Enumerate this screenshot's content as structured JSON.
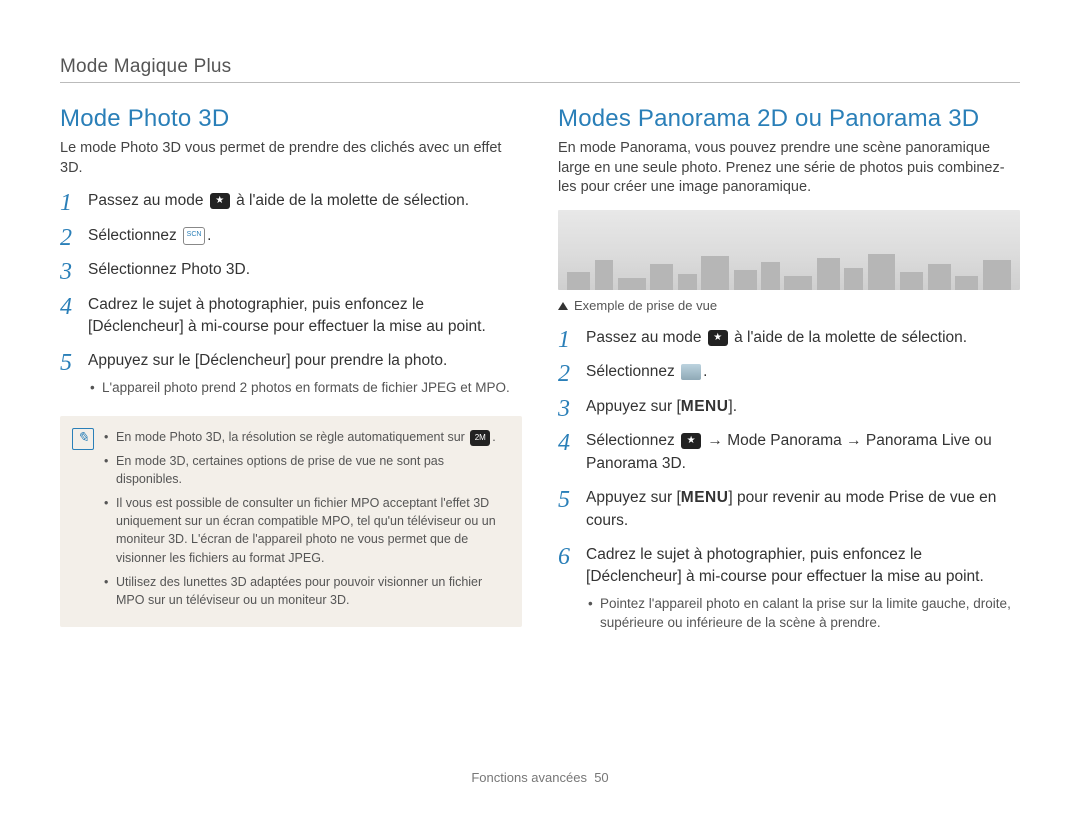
{
  "header": {
    "title": "Mode Magique Plus"
  },
  "left": {
    "heading": "Mode Photo 3D",
    "intro": "Le mode Photo 3D vous permet de prendre des clichés avec un effet 3D.",
    "steps": [
      {
        "pre": "Passez au mode ",
        "post": " à l'aide de la molette de sélection."
      },
      {
        "pre": "Sélectionnez ",
        "post": "."
      },
      {
        "pre": "Sélectionnez ",
        "bold": "Photo 3D",
        "post": "."
      },
      {
        "text": "Cadrez le sujet à photographier, puis enfoncez le [",
        "bold": "Déclencheur",
        "post": "] à mi-course pour effectuer la mise au point."
      },
      {
        "pre": "Appuyez sur le [",
        "bold": "Déclencheur",
        "post": "] pour prendre la photo.",
        "sub": "L'appareil photo prend 2 photos en formats de fichier JPEG et MPO."
      }
    ],
    "notes": [
      "En mode Photo 3D, la résolution se règle automatiquement sur ",
      "En mode 3D, certaines options de prise de vue ne sont pas disponibles.",
      "Il vous est possible de consulter un fichier MPO acceptant l'effet 3D uniquement sur un écran compatible MPO, tel qu'un téléviseur ou un moniteur 3D. L'écran de l'appareil photo ne vous permet que de visionner les fichiers au format JPEG.",
      "Utilisez des lunettes 3D adaptées pour pouvoir visionner un fichier MPO sur un téléviseur ou un moniteur 3D."
    ],
    "note1_post": "."
  },
  "right": {
    "heading": "Modes Panorama 2D ou Panorama 3D",
    "intro": "En mode Panorama, vous pouvez prendre une scène panoramique large en une seule photo. Prenez une série de photos puis combinez-les pour créer une image panoramique.",
    "caption": "Exemple de prise de vue",
    "steps": [
      {
        "pre": "Passez au mode ",
        "post": " à l'aide de la molette de sélection."
      },
      {
        "pre": "Sélectionnez ",
        "post": "."
      },
      {
        "pre": "Appuyez sur [",
        "menu": "MENU",
        "post": "]."
      },
      {
        "pre": "Sélectionnez ",
        "bold1": "Mode Panorama",
        "arrow1": " → ",
        "bold2": "Panorama Live",
        "or": " ou ",
        "bold3": "Panorama 3D",
        "post": "."
      },
      {
        "pre": "Appuyez sur [",
        "menu": "MENU",
        "post": "] pour revenir au mode Prise de vue en cours."
      },
      {
        "text": "Cadrez le sujet à photographier, puis enfoncez le [",
        "bold": "Déclencheur",
        "post": "] à mi-course pour effectuer la mise au point.",
        "sub": "Pointez l'appareil photo en calant la prise sur la limite gauche, droite, supérieure ou inférieure de la scène à prendre."
      }
    ]
  },
  "footer": {
    "section": "Fonctions avancées",
    "page": "50"
  }
}
